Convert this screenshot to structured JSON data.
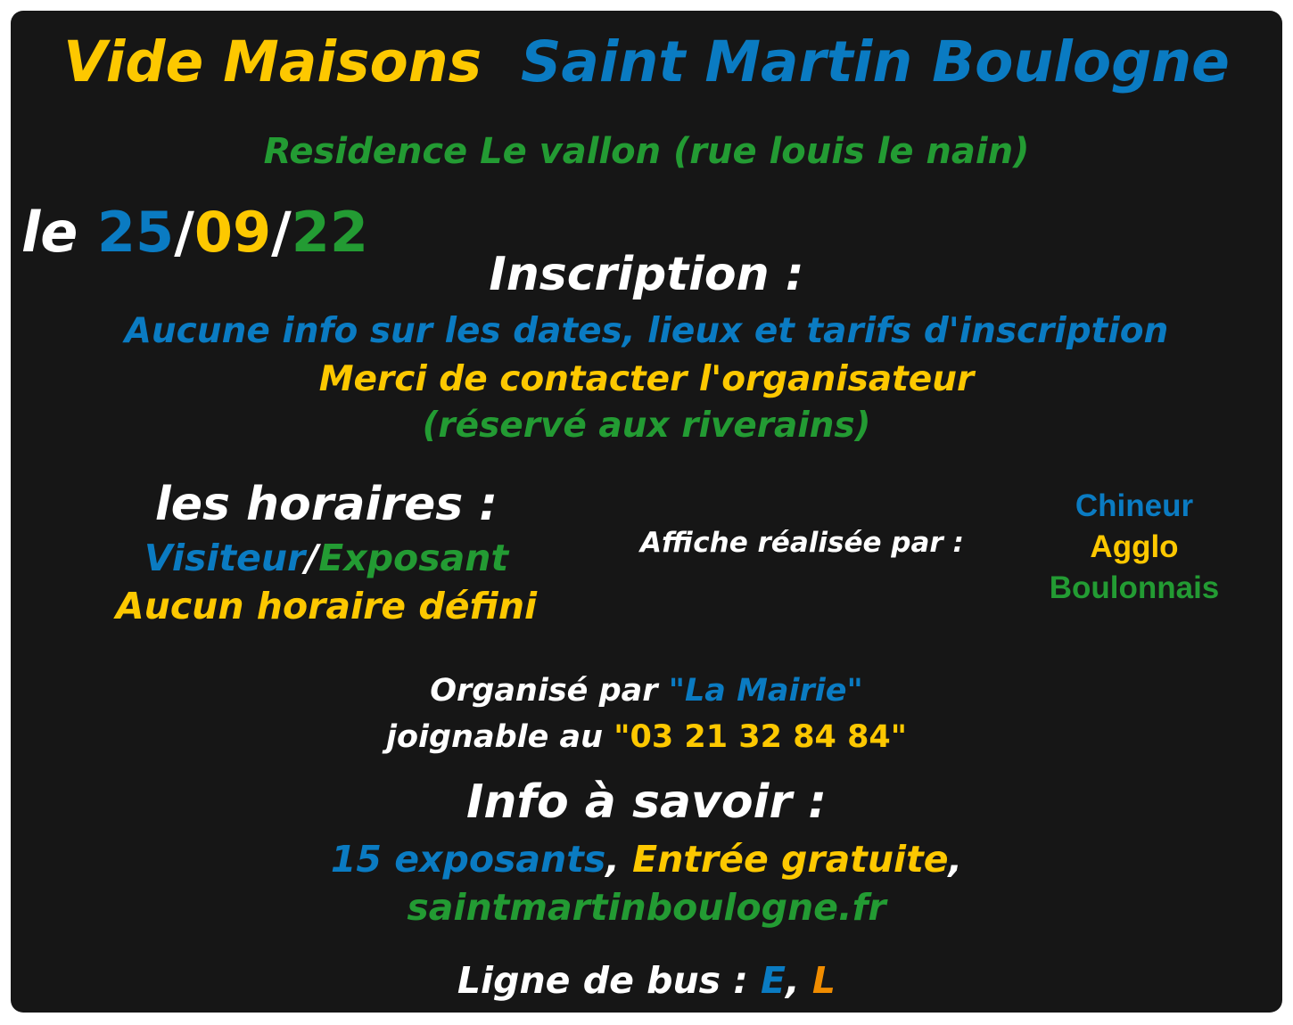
{
  "title": {
    "part1": "Vide Maisons",
    "part2": "Saint Martin Boulogne"
  },
  "location": "Residence Le vallon (rue louis le nain)",
  "date": {
    "prefix": "le",
    "day": "25",
    "sep1": "/",
    "month": "09",
    "sep2": "/",
    "year": "22"
  },
  "inscription": {
    "heading": "Inscription :",
    "line1": "Aucune info sur les dates, lieux et tarifs d'inscription",
    "line2": "Merci de contacter l'organisateur",
    "line3": "(réservé aux riverains)"
  },
  "horaires": {
    "heading": "les horaires :",
    "visiteur": "Visiteur",
    "sep": "/",
    "exposant": "Exposant",
    "none": "Aucun horaire défini"
  },
  "affiche": {
    "label": "Affiche réalisée par :",
    "credit1": "Chineur",
    "credit2": "Agglo",
    "credit3": "Boulonnais"
  },
  "organise": {
    "prefix": "Organisé par",
    "name": "\"La Mairie\"",
    "phone_prefix": "joignable au",
    "phone": "\"03 21 32 84 84\""
  },
  "info": {
    "heading": "Info à savoir :",
    "exposants": "15 exposants",
    "comma1": ",",
    "entree": "Entrée gratuite",
    "comma2": ",",
    "website": "saintmartinboulogne.fr"
  },
  "bus": {
    "prefix": "Ligne de bus :",
    "line1": "E",
    "comma": ",",
    "line2": "L"
  },
  "colors": {
    "background": "#161616",
    "white": "#ffffff",
    "blue": "#0a7bc2",
    "yellow": "#fdc800",
    "green": "#239b33",
    "orange": "#f08c00"
  }
}
